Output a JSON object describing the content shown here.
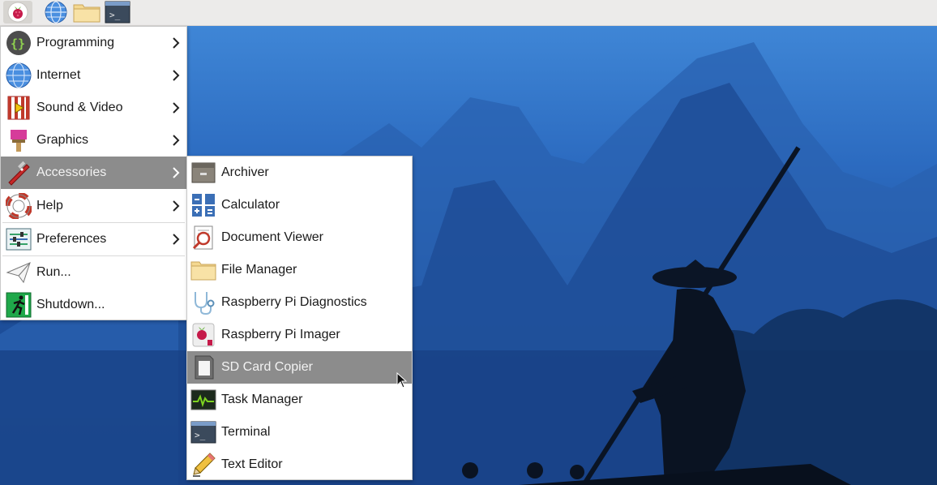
{
  "panel": {
    "launchers": [
      {
        "icon": "raspberry-pi-menu-icon"
      },
      {
        "icon": "web-browser-icon"
      },
      {
        "icon": "file-manager-icon"
      },
      {
        "icon": "terminal-icon"
      }
    ]
  },
  "main_menu": {
    "items": [
      {
        "label": "Programming",
        "icon": "programming-icon",
        "has_submenu": true
      },
      {
        "label": "Internet",
        "icon": "internet-icon",
        "has_submenu": true
      },
      {
        "label": "Sound & Video",
        "icon": "sound-video-icon",
        "has_submenu": true
      },
      {
        "label": "Graphics",
        "icon": "graphics-icon",
        "has_submenu": true
      },
      {
        "label": "Accessories",
        "icon": "accessories-icon",
        "has_submenu": true,
        "active": true
      },
      {
        "label": "Help",
        "icon": "help-icon",
        "has_submenu": true
      },
      {
        "label": "Preferences",
        "icon": "preferences-icon",
        "has_submenu": true
      },
      {
        "label": "Run...",
        "icon": "run-icon",
        "has_submenu": false
      },
      {
        "label": "Shutdown...",
        "icon": "shutdown-icon",
        "has_submenu": false
      }
    ]
  },
  "accessories_menu": {
    "items": [
      {
        "label": "Archiver",
        "icon": "archiver-icon"
      },
      {
        "label": "Calculator",
        "icon": "calculator-icon"
      },
      {
        "label": "Document Viewer",
        "icon": "document-viewer-icon"
      },
      {
        "label": "File Manager",
        "icon": "folder-icon"
      },
      {
        "label": "Raspberry Pi Diagnostics",
        "icon": "stethoscope-icon"
      },
      {
        "label": "Raspberry Pi Imager",
        "icon": "imager-icon"
      },
      {
        "label": "SD Card Copier",
        "icon": "sd-card-icon",
        "active": true
      },
      {
        "label": "Task Manager",
        "icon": "task-manager-icon"
      },
      {
        "label": "Terminal",
        "icon": "terminal-icon"
      },
      {
        "label": "Text Editor",
        "icon": "text-editor-icon"
      }
    ]
  },
  "colors": {
    "panel_bg": "#ecebea",
    "highlight": "#8c8c8c",
    "menu_bg": "#ffffff"
  }
}
